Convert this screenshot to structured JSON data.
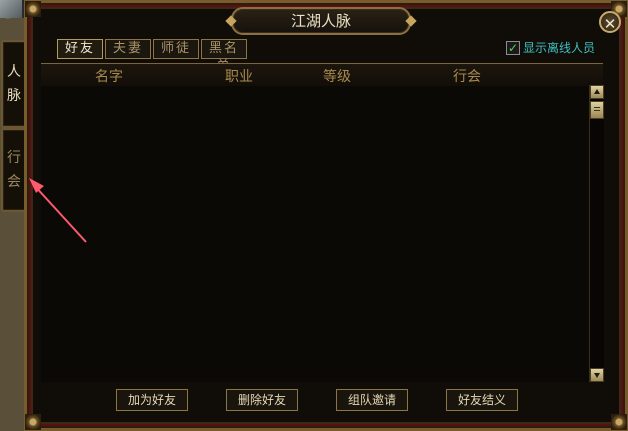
{
  "window": {
    "title": "江湖人脉",
    "close_glyph": "✕"
  },
  "side_tabs": [
    {
      "label_top": "人",
      "label_bottom": "脉"
    },
    {
      "label_top": "行",
      "label_bottom": "会"
    }
  ],
  "tabs": [
    {
      "label": "好友",
      "active": true
    },
    {
      "label": "夫妻",
      "active": false
    },
    {
      "label": "师徒",
      "active": false
    },
    {
      "label": "黑名单",
      "active": false
    }
  ],
  "offline_toggle": {
    "label": "显示离线人员",
    "checked": true,
    "check_glyph": "✓"
  },
  "list": {
    "columns": [
      "名字",
      "职业",
      "等级",
      "行会"
    ],
    "rows": []
  },
  "buttons": {
    "add_friend": "加为好友",
    "delete_friend": "删除好友",
    "team_invite": "组队邀请",
    "friend_bond": "好友结义"
  },
  "colors": {
    "accent_gold": "#a98a4e",
    "offline_label": "#3ec0c0",
    "arrow": "#ff5a6e"
  }
}
